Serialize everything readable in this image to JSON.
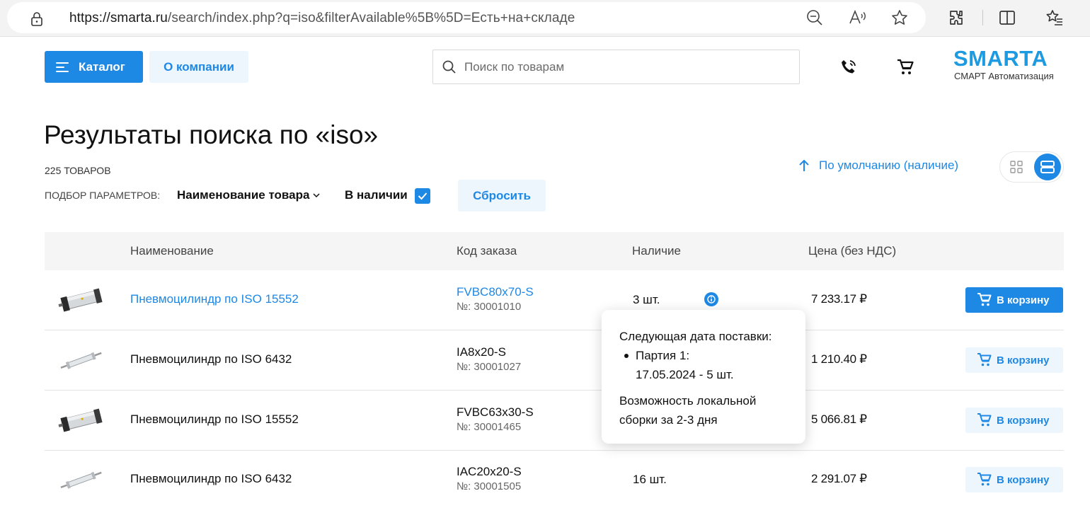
{
  "browser": {
    "url_host": "https://smarta.ru",
    "url_path": "/search/index.php?q=iso&filterAvailable%5B%5D=Есть+на+складе"
  },
  "header": {
    "catalog_label": "Каталог",
    "about_label": "О компании",
    "search_placeholder": "Поиск по товарам",
    "logo_brand": "SMARTA",
    "logo_sub": "СМАРТ Автоматизация"
  },
  "page": {
    "title": "Результаты поиска по «iso»",
    "count": "225 ТОВАРОВ",
    "filters_label": "ПОДБОР ПАРАМЕТРОВ:",
    "filter_name": "Наименование товара",
    "stock_filter": "В наличии",
    "reset_label": "Сбросить",
    "sort_label": "По умолчанию (наличие)"
  },
  "table": {
    "headers": [
      "Наименование",
      "Код заказа",
      "Наличие",
      "Цена (без НДС)"
    ],
    "rows": [
      {
        "name": "Пневмоцилиндр по ISO 15552",
        "code": "FVBC80x70-S",
        "num": "№: 30001010",
        "stock": "3 шт.",
        "price": "7 233.17 ₽",
        "cart": "В корзину"
      },
      {
        "name": "Пневмоцилиндр по ISO 6432",
        "code": "IA8x20-S",
        "num": "№: 30001027",
        "stock": "",
        "price": "1 210.40 ₽",
        "cart": "В корзину"
      },
      {
        "name": "Пневмоцилиндр по ISO 15552",
        "code": "FVBC63x30-S",
        "num": "№: 30001465",
        "stock": "",
        "price": "5 066.81 ₽",
        "cart": "В корзину"
      },
      {
        "name": "Пневмоцилиндр по ISO 6432",
        "code": "IAC20x20-S",
        "num": "№: 30001505",
        "stock": "16 шт.",
        "price": "2 291.07 ₽",
        "cart": "В корзину"
      }
    ]
  },
  "tooltip": {
    "heading": "Следующая дата поставки:",
    "batch_title": "Партия 1:",
    "batch_detail": "17.05.2024 - 5 шт.",
    "note": "Возможность локальной сборки за 2-3 дня"
  },
  "colors": {
    "accent": "#1e88e5",
    "accent_light": "#eef6fd",
    "logo": "#1e9be0"
  }
}
